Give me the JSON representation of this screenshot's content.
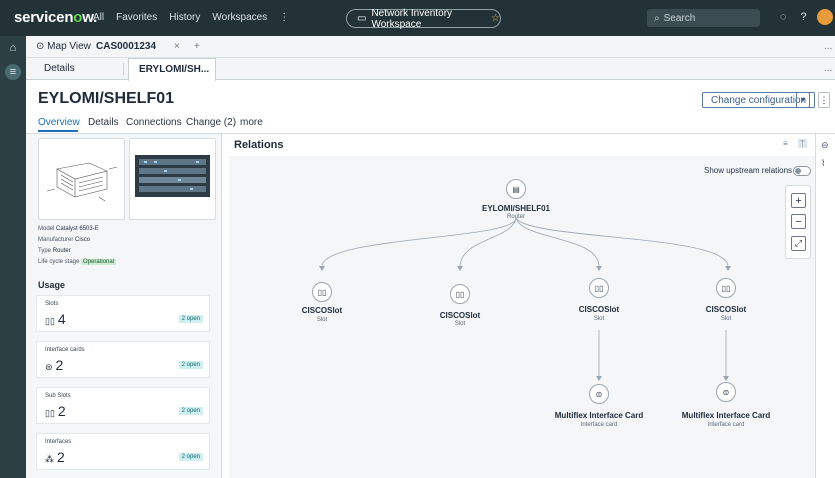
{
  "topbar": {
    "brand_prefix": "servicen",
    "brand_o": "o",
    "brand_suffix": "w.",
    "nav": [
      "All",
      "Favorites",
      "History",
      "Workspaces",
      "⋮"
    ],
    "workspace_label": "Network Inventory Workspace",
    "search_placeholder": "Search",
    "brand_color": "#62d84e"
  },
  "tabs": {
    "map_view": "Map View",
    "record_tab": "CAS0001234",
    "close": "×",
    "add": "+",
    "details": "Details",
    "active_subtab": "ERYLOMI/SH...",
    "overflow": "..."
  },
  "record": {
    "title": "EYLOMI/SHELF01",
    "change_button": "Change configuration",
    "tabs": [
      "Overview",
      "Details",
      "Connections",
      "Change (2)",
      "more"
    ]
  },
  "properties": {
    "model_label": "Model",
    "model": "Catalyst 6503-E",
    "manufacturer_label": "Manufacturer",
    "manufacturer": "Cisco",
    "type_label": "Type",
    "type": "Router",
    "lifecycle_label": "Life cycle stage",
    "lifecycle": "Operational"
  },
  "usage": {
    "title": "Usage",
    "cards": [
      {
        "label": "Slots",
        "value": "4",
        "badge": "2 open",
        "icon": "slot-icon"
      },
      {
        "label": "Interface cards",
        "value": "2",
        "badge": "2 open",
        "icon": "card-icon"
      },
      {
        "label": "Sub Slots",
        "value": "2",
        "badge": "2 open",
        "icon": "slot-icon"
      },
      {
        "label": "Interfaces",
        "value": "2",
        "badge": "2 open",
        "icon": "network-icon"
      }
    ]
  },
  "relations": {
    "title": "Relations",
    "show_upstream": "Show upstream relations",
    "zoom_in": "+",
    "zoom_out": "−",
    "fit": "⤢",
    "root": {
      "name": "EYLOMI/SHELF01",
      "type": "Router"
    },
    "slots": [
      {
        "name": "CISCOSlot",
        "type": "Slot"
      },
      {
        "name": "CISCOSlot",
        "type": "Slot"
      },
      {
        "name": "CISCOSlot",
        "type": "Slot"
      },
      {
        "name": "CISCOSlot",
        "type": "Slot"
      }
    ],
    "cards": [
      {
        "name": "Multiflex Interface Card",
        "type": "Interface card"
      },
      {
        "name": "Multiflex Interface Card",
        "type": "Interface card"
      }
    ]
  }
}
